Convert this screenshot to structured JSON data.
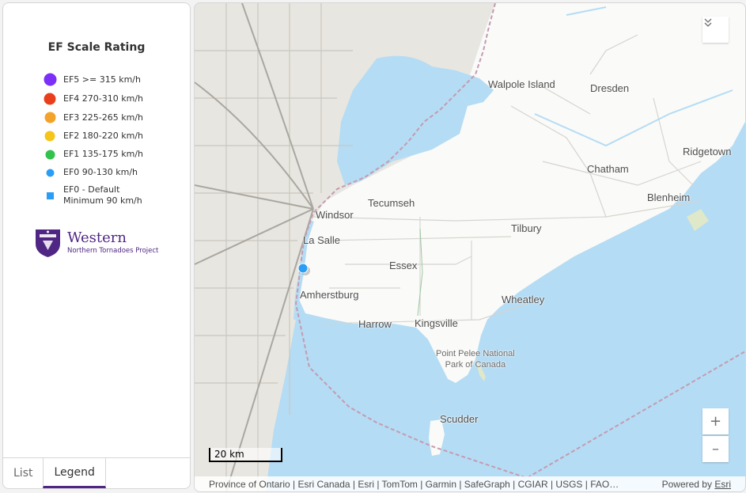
{
  "legend": {
    "title": "EF Scale Rating",
    "items": [
      {
        "label": "EF5  >= 315 km/h",
        "color": "#7b2ff7",
        "shape": "circle"
      },
      {
        "label": "EF4  270-310 km/h",
        "color": "#e8401c",
        "shape": "circle"
      },
      {
        "label": "EF3  225-265 km/h",
        "color": "#f4a32a",
        "shape": "circle"
      },
      {
        "label": "EF2  180-220 km/h",
        "color": "#f5c518",
        "shape": "circle"
      },
      {
        "label": "EF1  135-175 km/h",
        "color": "#33c24d",
        "shape": "circle"
      },
      {
        "label": "EF0  90-130 km/h",
        "color": "#2a9df4",
        "shape": "circle"
      },
      {
        "label_line1": "EF0 - Default",
        "label_line2": "Minimum 90 km/h",
        "color": "#2a9df4",
        "shape": "square"
      }
    ]
  },
  "logo": {
    "name": "Western",
    "subtitle": "Northern Tornadoes Project"
  },
  "tabs": [
    {
      "label": "List",
      "active": false
    },
    {
      "label": "Legend",
      "active": true
    }
  ],
  "map": {
    "places": {
      "walpole_island": "Walpole Island",
      "dresden": "Dresden",
      "ridgetown": "Ridgetown",
      "chatham": "Chatham",
      "blenheim": "Blenheim",
      "tecumseh": "Tecumseh",
      "windsor": "Windsor",
      "la_salle": "La Salle",
      "tilbury": "Tilbury",
      "essex": "Essex",
      "amherstburg": "Amherstburg",
      "wheatley": "Wheatley",
      "harrow": "Harrow",
      "kingsville": "Kingsville",
      "point_pelee_1": "Point Pelee National",
      "point_pelee_2": "Park of Canada",
      "scudder": "Scudder"
    },
    "scale_label": "20 km",
    "zoom_in": "+",
    "zoom_out": "–",
    "attribution": "Province of Ontario | Esri Canada | Esri | TomTom | Garmin | SafeGraph | CGIAR | USGS | FAO…",
    "powered_by": "Powered by",
    "powered_link": "Esri"
  }
}
